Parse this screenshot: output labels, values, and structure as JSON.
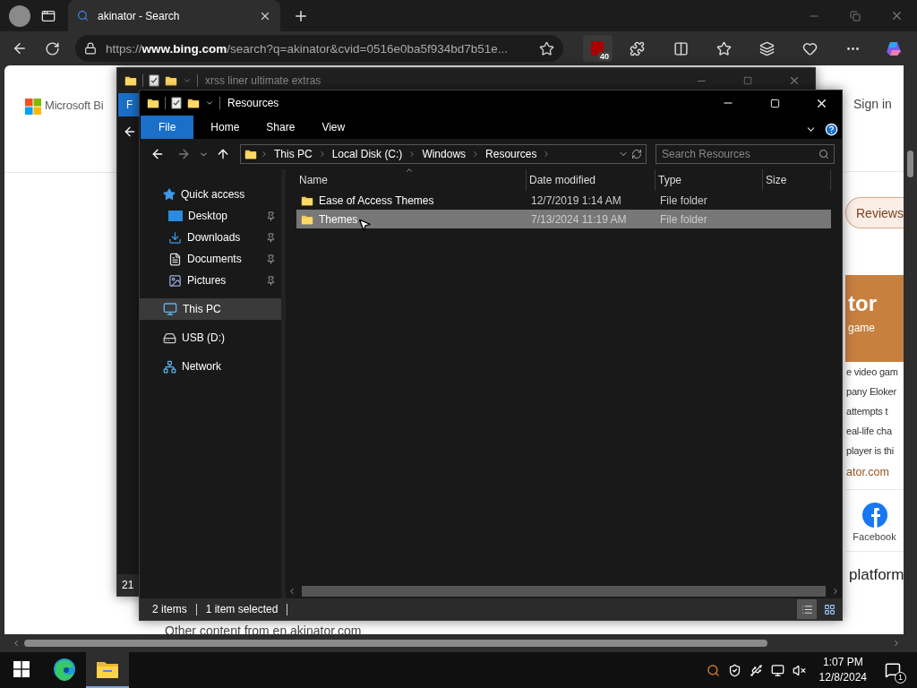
{
  "browser": {
    "tab": {
      "title": "akinator - Search"
    },
    "address": "https://**www.bing.com**/search?q=akinator&cvid=0516e0ba5f934bd7b51e...",
    "extension_badge": "40"
  },
  "page": {
    "logo_text": "Microsoft Bi",
    "sign_in": "Sign in",
    "pill": "Reviews",
    "card_title": "tor",
    "card_subtitle": "game",
    "snippet_lines": [
      "e video gam",
      "pany Eloker",
      "attempts t",
      "eal-life cha",
      "player is thi"
    ],
    "link": "ator.com",
    "social_label": "Facebook",
    "heading": "platform",
    "footer": "Other content from en.akinator.com"
  },
  "back_window": {
    "title": "xrss liner ultimate extras",
    "ribbon_tab": "F",
    "status": "21"
  },
  "window": {
    "title": "Resources",
    "ribbon_tabs": [
      {
        "label": "File",
        "selected": true
      },
      {
        "label": "Home",
        "selected": false
      },
      {
        "label": "Share",
        "selected": false
      },
      {
        "label": "View",
        "selected": false
      }
    ],
    "breadcrumb": [
      "This PC",
      "Local Disk (C:)",
      "Windows",
      "Resources"
    ],
    "search": {
      "placeholder": "Search Resources"
    },
    "nav": [
      {
        "label": "Quick access",
        "kind": "quick",
        "selected": false,
        "children": [
          {
            "label": "Desktop",
            "kind": "desktop",
            "selected": false,
            "pinned": true
          },
          {
            "label": "Downloads",
            "kind": "downloads",
            "selected": false,
            "pinned": true
          },
          {
            "label": "Documents",
            "kind": "documents",
            "selected": false,
            "pinned": true
          },
          {
            "label": "Pictures",
            "kind": "pictures",
            "selected": false,
            "pinned": true
          }
        ]
      },
      {
        "label": "This PC",
        "kind": "pc",
        "selected": true
      },
      {
        "label": "USB (D:)",
        "kind": "drive",
        "selected": false
      },
      {
        "label": "Network",
        "kind": "network",
        "selected": false
      }
    ],
    "columns": [
      "Name",
      "Date modified",
      "Type",
      "Size"
    ],
    "rows": [
      {
        "name": "Ease of Access Themes",
        "date": "12/7/2019 1:14 AM",
        "type": "File folder",
        "selected": false
      },
      {
        "name": "Themes",
        "date": "7/13/2024 11:19 AM",
        "type": "File folder",
        "selected": true
      }
    ],
    "status": {
      "count": "2 items",
      "selection": "1 item selected"
    }
  },
  "taskbar": {
    "apps": [
      {
        "kind": "edge",
        "active": false
      },
      {
        "kind": "explorer",
        "active": true
      }
    ],
    "time": "1:07 PM",
    "date": "12/8/2024",
    "notifications": "1"
  }
}
